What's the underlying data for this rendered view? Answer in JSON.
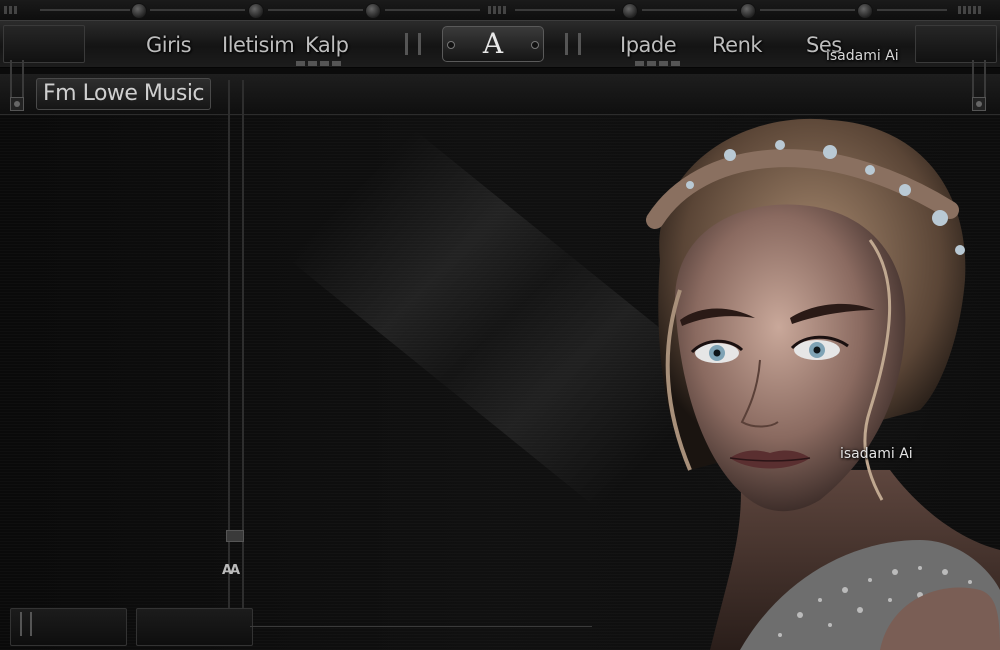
{
  "nav": {
    "links": [
      "Giris",
      "Iletisim",
      "Kalp",
      "Ipade",
      "Renk",
      "Ses"
    ],
    "emblem": "A"
  },
  "watermark": "isadami Ai",
  "title": "Fm Lowe Music",
  "scroll": {
    "grip": "AA"
  },
  "colors": {
    "background": "#0b0b0b",
    "chrome": "#1c1c1c",
    "text": "#bdbdbd"
  },
  "icons": {
    "emblem": "letter-a-logo",
    "portrait": "woman-portrait-image"
  }
}
